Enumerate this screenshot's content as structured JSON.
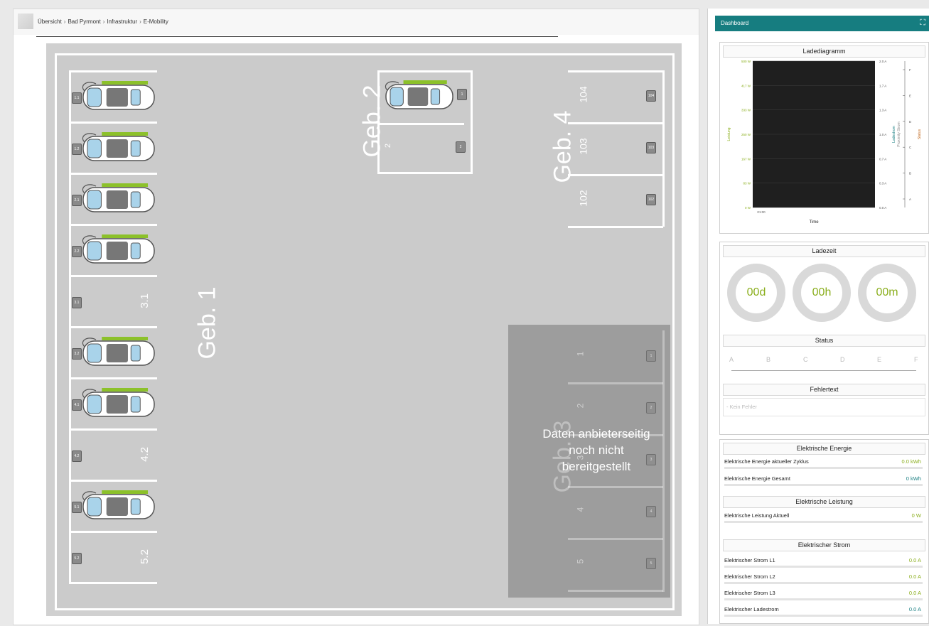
{
  "breadcrumb": [
    "Übersicht",
    "Bad Pyrmont",
    "Infrastruktur",
    "E-Mobility"
  ],
  "lot": {
    "geb1": "Geb. 1",
    "geb2": "Geb. 2",
    "geb3": "Geb. 3",
    "geb4": "Geb. 4",
    "geb3_notice": "Daten anbieterseitig noch nicht bereitgestellt",
    "geb1_spots": [
      {
        "tag": "1.1",
        "occupied": true
      },
      {
        "tag": "1.2",
        "occupied": true
      },
      {
        "tag": "2.1",
        "occupied": true
      },
      {
        "tag": "2.2",
        "occupied": true
      },
      {
        "tag": "3.1",
        "occupied": false,
        "label": "3.1"
      },
      {
        "tag": "3.2",
        "occupied": true
      },
      {
        "tag": "4.1",
        "occupied": true
      },
      {
        "tag": "4.2",
        "occupied": false,
        "label": "4.2"
      },
      {
        "tag": "5.1",
        "occupied": true
      },
      {
        "tag": "5.2",
        "occupied": false,
        "label": "5.2"
      }
    ],
    "geb2_spots": [
      {
        "tag": "1",
        "occupied": true
      },
      {
        "tag": "2",
        "occupied": false,
        "label": "2"
      }
    ],
    "geb4_spots": [
      {
        "tag": "104",
        "label": "104"
      },
      {
        "tag": "103",
        "label": "103"
      },
      {
        "tag": "102",
        "label": "102"
      }
    ],
    "geb3_spots": [
      {
        "tag": "1",
        "label": "1"
      },
      {
        "tag": "2",
        "label": "2"
      },
      {
        "tag": "3",
        "label": "3"
      },
      {
        "tag": "4",
        "label": "4"
      },
      {
        "tag": "5",
        "label": "5"
      }
    ]
  },
  "dashboard": {
    "title": "Dashboard",
    "expand_icon": "expand-icon",
    "chart_title": "Ladediagramm",
    "ladezeit_title": "Ladezeit",
    "ladezeit": [
      "00d",
      "00h",
      "00m"
    ],
    "status_title": "Status",
    "status_steps": [
      "A",
      "B",
      "C",
      "D",
      "E",
      "F"
    ],
    "fehler_title": "Fehlertext",
    "fehler_text": "- Kein Fehler",
    "energie_title": "Elektrische Energie",
    "energie_rows": [
      {
        "label": "Elektrische Energie aktueller Zyklus",
        "value": "0.0 kWh",
        "color": "#8aae1c"
      },
      {
        "label": "Elektrische Energie Gesamt",
        "value": "0 kWh",
        "color": "#167d80"
      }
    ],
    "leistung_title": "Elektrische Leistung",
    "leistung_rows": [
      {
        "label": "Elektrische Leistung Aktuell",
        "value": "0 W",
        "color": "#8aae1c"
      }
    ],
    "strom_title": "Elektrischer Strom",
    "strom_rows": [
      {
        "label": "Elektrischer Strom L1",
        "value": "0.0 A",
        "color": "#8aae1c"
      },
      {
        "label": "Elektrischer Strom L2",
        "value": "0.0 A",
        "color": "#8aae1c"
      },
      {
        "label": "Elektrischer Strom L3",
        "value": "0.0 A",
        "color": "#8aae1c"
      },
      {
        "label": "Elektrischer Ladestrom",
        "value": "0.0 A",
        "color": "#167d80"
      }
    ]
  },
  "chart_data": {
    "type": "line",
    "title": "Ladediagramm",
    "xlabel": "Time",
    "x_ticks": [
      "01:00"
    ],
    "y_left_label": "Leistung",
    "y_left_ticks": [
      "0 W",
      "83 W",
      "167 W",
      "250 W",
      "333 W",
      "417 W",
      "500 W"
    ],
    "y_right_label": "Ladestrom",
    "y_right_label2": "Proximity Strom",
    "y_right_ticks": [
      "0.0 A",
      "0.3 A",
      "0.7 A",
      "1.0 A",
      "1.3 A",
      "1.7 A",
      "2.0 A"
    ],
    "y_status_label": "Status",
    "y_status_ticks": [
      "A",
      "B",
      "C",
      "D",
      "E",
      "F"
    ],
    "series": [],
    "colors": {
      "leistung": "#8aae1c",
      "ladestrom": "#167d80",
      "proximity": "#8a8a8a",
      "status": "#c0651a",
      "plot_bg": "#1f1f1f"
    }
  }
}
